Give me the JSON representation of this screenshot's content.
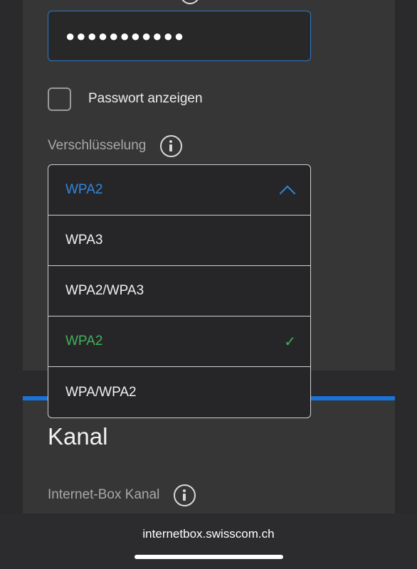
{
  "password": {
    "masked_value": "●●●●●●●●●●●"
  },
  "show_password": {
    "label": "Passwort anzeigen",
    "checked": false
  },
  "encryption": {
    "label": "Verschlüsselung",
    "selected": "WPA2",
    "options": [
      {
        "label": "WPA3",
        "selected": false
      },
      {
        "label": "WPA2/WPA3",
        "selected": false
      },
      {
        "label": "WPA2",
        "selected": true
      },
      {
        "label": "WPA/WPA2",
        "selected": false
      }
    ],
    "check_glyph": "✓"
  },
  "channel": {
    "title": "Kanal",
    "label": "Internet-Box Kanal"
  },
  "browser": {
    "url": "internetbox.swisscom.ch"
  },
  "colors": {
    "accent_blue": "#2f86e0",
    "selected_green": "#3fb159",
    "card_bg": "#363636",
    "page_bg": "#2a2a2c"
  },
  "icons": [
    "info-icon",
    "chevron-up-icon",
    "checkmark-icon"
  ]
}
